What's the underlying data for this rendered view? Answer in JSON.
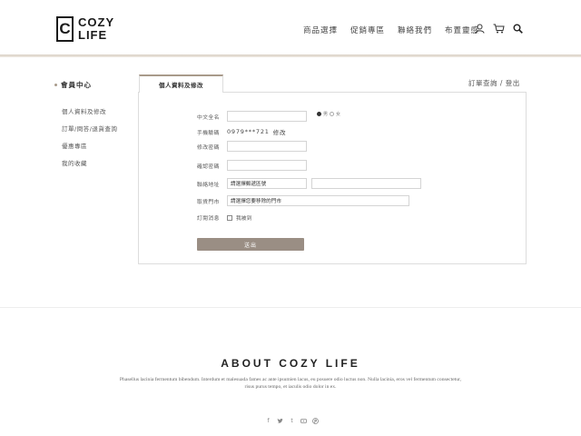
{
  "logo": {
    "box": "C",
    "line1": "COZY",
    "line2": "LIFE"
  },
  "nav": [
    "商品選擇",
    "促銷專區",
    "聯絡我們",
    "布置靈感"
  ],
  "nav_icons": [
    "user-icon",
    "cart-icon",
    "search-icon"
  ],
  "sidebar": {
    "title": "會員中心",
    "items": [
      "個人資料及修改",
      "訂單/問答/退貨查詢",
      "優惠專區",
      "我的收藏"
    ]
  },
  "tabs": {
    "active": "個人資料及修改",
    "right_1": "訂單查詢",
    "sep": " / ",
    "right_2": "登出"
  },
  "form": {
    "name_label": "中文全名",
    "name_value": "",
    "gender_male": "男",
    "gender_female": "女",
    "gender_selected": "男",
    "phone_label": "手機驗碼",
    "phone_value": "0979***721",
    "phone_edit": "修改",
    "pwd_label": "修改密碼",
    "pwd_confirm_label": "確認密碼",
    "addr_label": "聯絡地址",
    "addr_placeholder": "請選擇郵遞區號",
    "store_label": "取貨門市",
    "store_placeholder": "請選擇您要移除的門市",
    "sub_label": "訂閱消息",
    "sub_text": "我被到",
    "submit": "送出"
  },
  "footer": {
    "title": "ABOUT COZY LIFE",
    "text": "Phasellus lacinia fermentum bibendum. Interdum et malesuada fames ac ante ipsumien lacus, eu posuere odio luctus non. Nulla lacinia, eros vel fermentum consectetur, risus purus tempo, et iaculis odio dolor in ex.",
    "socials": [
      "facebook-icon",
      "twitter-icon",
      "tumblr-icon",
      "youtube-icon",
      "pinterest-icon"
    ]
  }
}
